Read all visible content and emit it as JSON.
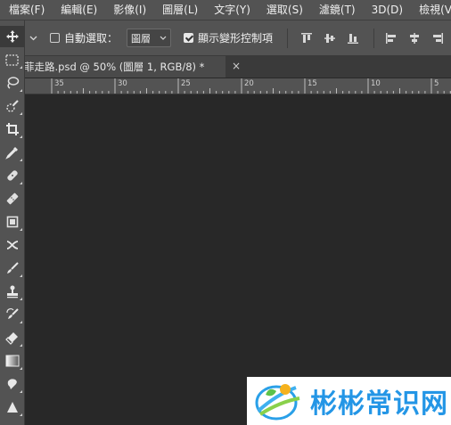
{
  "menubar": {
    "items": [
      "檔案(F)",
      "編輯(E)",
      "影像(I)",
      "圖層(L)",
      "文字(Y)",
      "選取(S)",
      "濾鏡(T)",
      "3D(D)",
      "檢視(V)"
    ]
  },
  "options": {
    "auto_select_label": "自動選取：",
    "auto_select_checked": false,
    "auto_select_target": "圖層",
    "show_transform_label": "顯示變形控制項",
    "show_transform_checked": true
  },
  "document_tab": {
    "title": "菲走路.psd @ 50% (圖層 1, RGB/8) *",
    "close_glyph": "×"
  },
  "ruler": {
    "labels": [
      "35",
      "30",
      "25",
      "20",
      "15",
      "10",
      "5"
    ]
  },
  "tools": [
    {
      "name": "move-tool",
      "icon": "move-icon"
    },
    {
      "name": "marquee-tool",
      "icon": "rect-marquee-icon"
    },
    {
      "name": "lasso-tool",
      "icon": "lasso-icon"
    },
    {
      "name": "quick-select-tool",
      "icon": "quick-select-icon"
    },
    {
      "name": "crop-tool",
      "icon": "crop-icon"
    },
    {
      "name": "eyedropper-tool",
      "icon": "eyedropper-icon"
    },
    {
      "name": "spot-healing-tool",
      "icon": "bandage-icon"
    },
    {
      "name": "healing-tool",
      "icon": "bandage-alt-icon"
    },
    {
      "name": "patch-tool",
      "icon": "patch-icon"
    },
    {
      "name": "content-aware-move-tool",
      "icon": "content-aware-move-icon"
    },
    {
      "name": "brush-tool",
      "icon": "brush-icon"
    },
    {
      "name": "clone-stamp-tool",
      "icon": "stamp-icon"
    },
    {
      "name": "history-brush-tool",
      "icon": "history-brush-icon"
    },
    {
      "name": "eraser-tool",
      "icon": "eraser-icon"
    },
    {
      "name": "gradient-tool",
      "icon": "gradient-icon"
    },
    {
      "name": "smudge-tool",
      "icon": "smudge-icon"
    },
    {
      "name": "sharpen-tool",
      "icon": "triangle-icon"
    }
  ],
  "watermark": {
    "text": "彬彬常识网",
    "color": "#2496e6"
  }
}
